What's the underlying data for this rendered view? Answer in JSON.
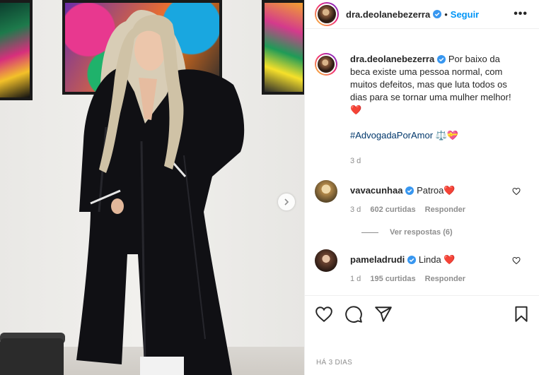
{
  "post": {
    "username": "dra.deolanebezerra",
    "follow_label": "Seguir",
    "dot": "•",
    "more": "•••",
    "caption": "Por baixo da beca existe uma pessoa normal, com muitos defeitos, mas que luta todos os dias para se tornar uma mulher melhor! ❤️",
    "hashtag": "#AdvogadaPorAmor",
    "hashtag_emoji": "⚖️💝",
    "caption_time": "3 d",
    "posted_ago": "HÁ 3 DIAS"
  },
  "comments": [
    {
      "username": "vavacunhaa",
      "text": "Patroa❤️",
      "time": "3 d",
      "likes": "602 curtidas",
      "reply_label": "Responder",
      "replies_label": "Ver respostas (6)"
    },
    {
      "username": "pameladrudi",
      "text": "Linda ❤️",
      "time": "1 d",
      "likes": "195 curtidas",
      "reply_label": "Responder"
    }
  ],
  "colors": {
    "accent": "#0095f6",
    "verified": "#3897f0",
    "muted": "#8e8e8e",
    "hashtag": "#00376b"
  },
  "icons": [
    "verified-icon",
    "heart-icon",
    "comment-icon",
    "share-icon",
    "bookmark-icon",
    "chevron-right-icon",
    "more-icon"
  ]
}
